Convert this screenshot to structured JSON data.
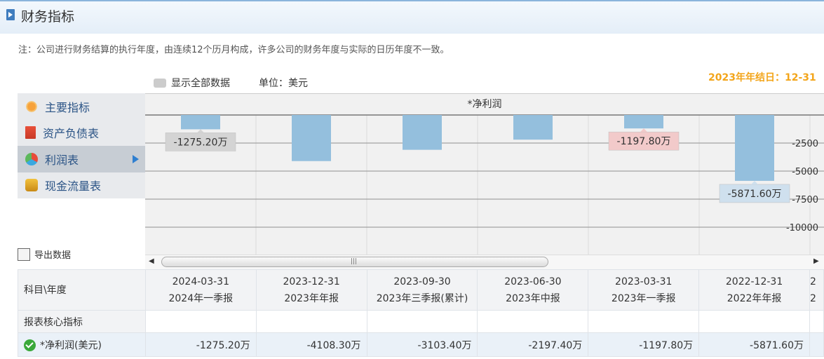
{
  "header": {
    "title": "财务指标"
  },
  "note": "注：公司进行财务结算的执行年度，由连续12个历月构成，许多公司的财务年度与实际的日历年度不一致。",
  "toolbar": {
    "show_all": "显示全部数据",
    "unit": "单位：美元"
  },
  "year_end": "2023年年结日：12-31",
  "menu": {
    "items": [
      {
        "label": "主要指标",
        "icon": "sun-icon"
      },
      {
        "label": "资产负债表",
        "icon": "document-icon"
      },
      {
        "label": "利润表",
        "icon": "pie-chart-icon",
        "active": true
      },
      {
        "label": "现金流量表",
        "icon": "coins-icon"
      }
    ]
  },
  "export_label": "导出数据",
  "chart_data": {
    "type": "bar",
    "title": "*净利润",
    "categories": [
      "2024-03-31",
      "2023-12-31",
      "2023-09-30",
      "2023-06-30",
      "2023-03-31",
      "2022-12-31"
    ],
    "values": [
      -1275.2,
      -4108.3,
      -3103.4,
      -2197.4,
      -1197.8,
      -5871.6
    ],
    "y_ticks": [
      "-2500",
      "-5000",
      "-7500",
      "-10000"
    ],
    "ylim": [
      -12500,
      0
    ],
    "data_labels": [
      {
        "index": 0,
        "text": "-1275.20万",
        "bg": "#d4d4d4"
      },
      {
        "index": 4,
        "text": "-1197.80万",
        "bg": "#f2caca"
      },
      {
        "index": 5,
        "text": "-5871.60万",
        "bg": "#cfe0ee"
      }
    ],
    "bar_color": "#94bfdd"
  },
  "table": {
    "corner": "科目\\年度",
    "columns": [
      {
        "date": "2024-03-31",
        "period": "2024年一季报"
      },
      {
        "date": "2023-12-31",
        "period": "2023年年报"
      },
      {
        "date": "2023-09-30",
        "period": "2023年三季报(累计)"
      },
      {
        "date": "2023-06-30",
        "period": "2023年中报"
      },
      {
        "date": "2023-03-31",
        "period": "2023年一季报"
      },
      {
        "date": "2022-12-31",
        "period": "2022年年报"
      }
    ],
    "partial_col": {
      "date": "2",
      "period": "2"
    },
    "section": "报表核心指标",
    "row": {
      "label": "*净利润(美元)",
      "values": [
        "-1275.20万",
        "-4108.30万",
        "-3103.40万",
        "-2197.40万",
        "-1197.80万",
        "-5871.60万"
      ]
    }
  }
}
